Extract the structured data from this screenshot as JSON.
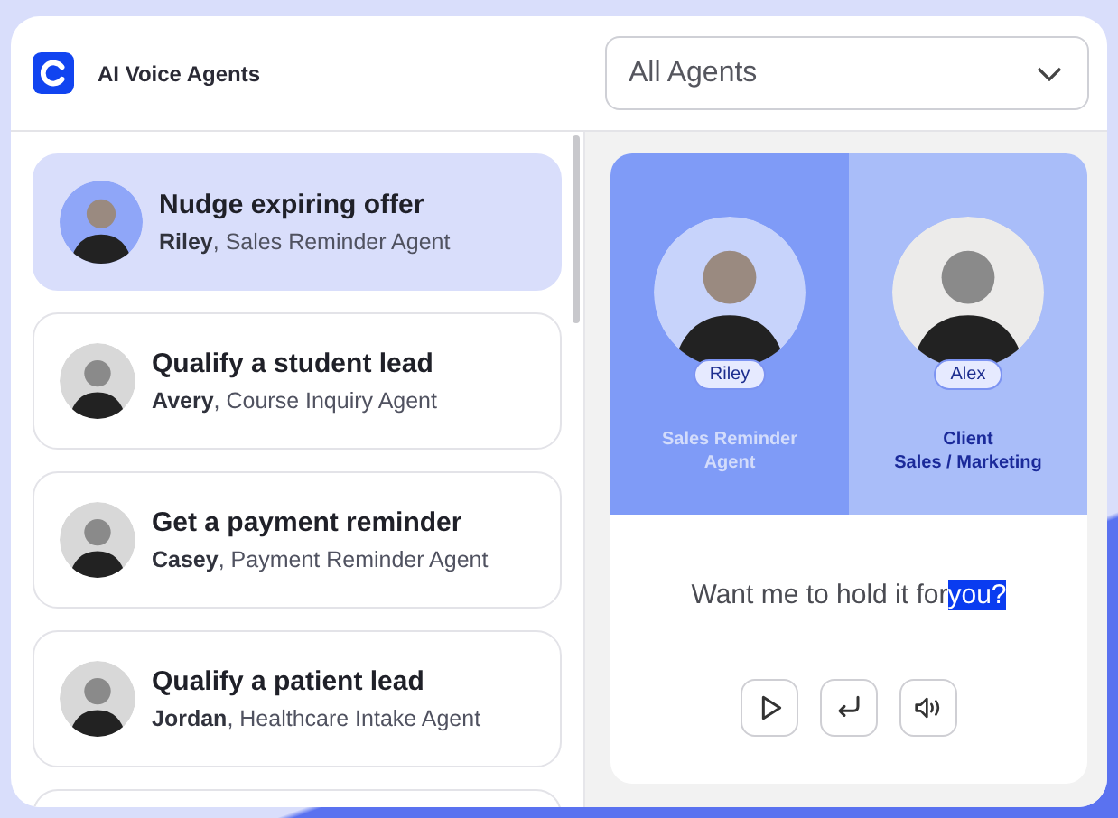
{
  "header": {
    "title": "AI Voice Agents",
    "filter": {
      "value": "All Agents"
    }
  },
  "scenarios": [
    {
      "title": "Nudge expiring offer",
      "agent": "**Riley**, Sales Reminder Agent",
      "selected": true
    },
    {
      "title": "Qualify a student lead",
      "agent": "**Avery**, Course Inquiry Agent",
      "selected": false
    },
    {
      "title": "Get a payment reminder",
      "agent": "**Casey**, Payment Reminder Agent",
      "selected": false
    },
    {
      "title": "Qualify a patient lead",
      "agent": "**Jordan**, Healthcare Intake Agent",
      "selected": false
    }
  ],
  "call": {
    "speakers": [
      {
        "name": "Riley",
        "lines": [
          "Sales Reminder",
          "Agent"
        ],
        "active": true
      },
      {
        "name": "Alex",
        "lines": [
          "Client",
          "Sales / Marketing"
        ],
        "active": false
      }
    ],
    "transcript": {
      "text": "Want me to hold it for",
      "highlight": "you?"
    },
    "controls": [
      {
        "kind": "play"
      },
      {
        "kind": "replay"
      },
      {
        "kind": "volume"
      }
    ]
  }
}
